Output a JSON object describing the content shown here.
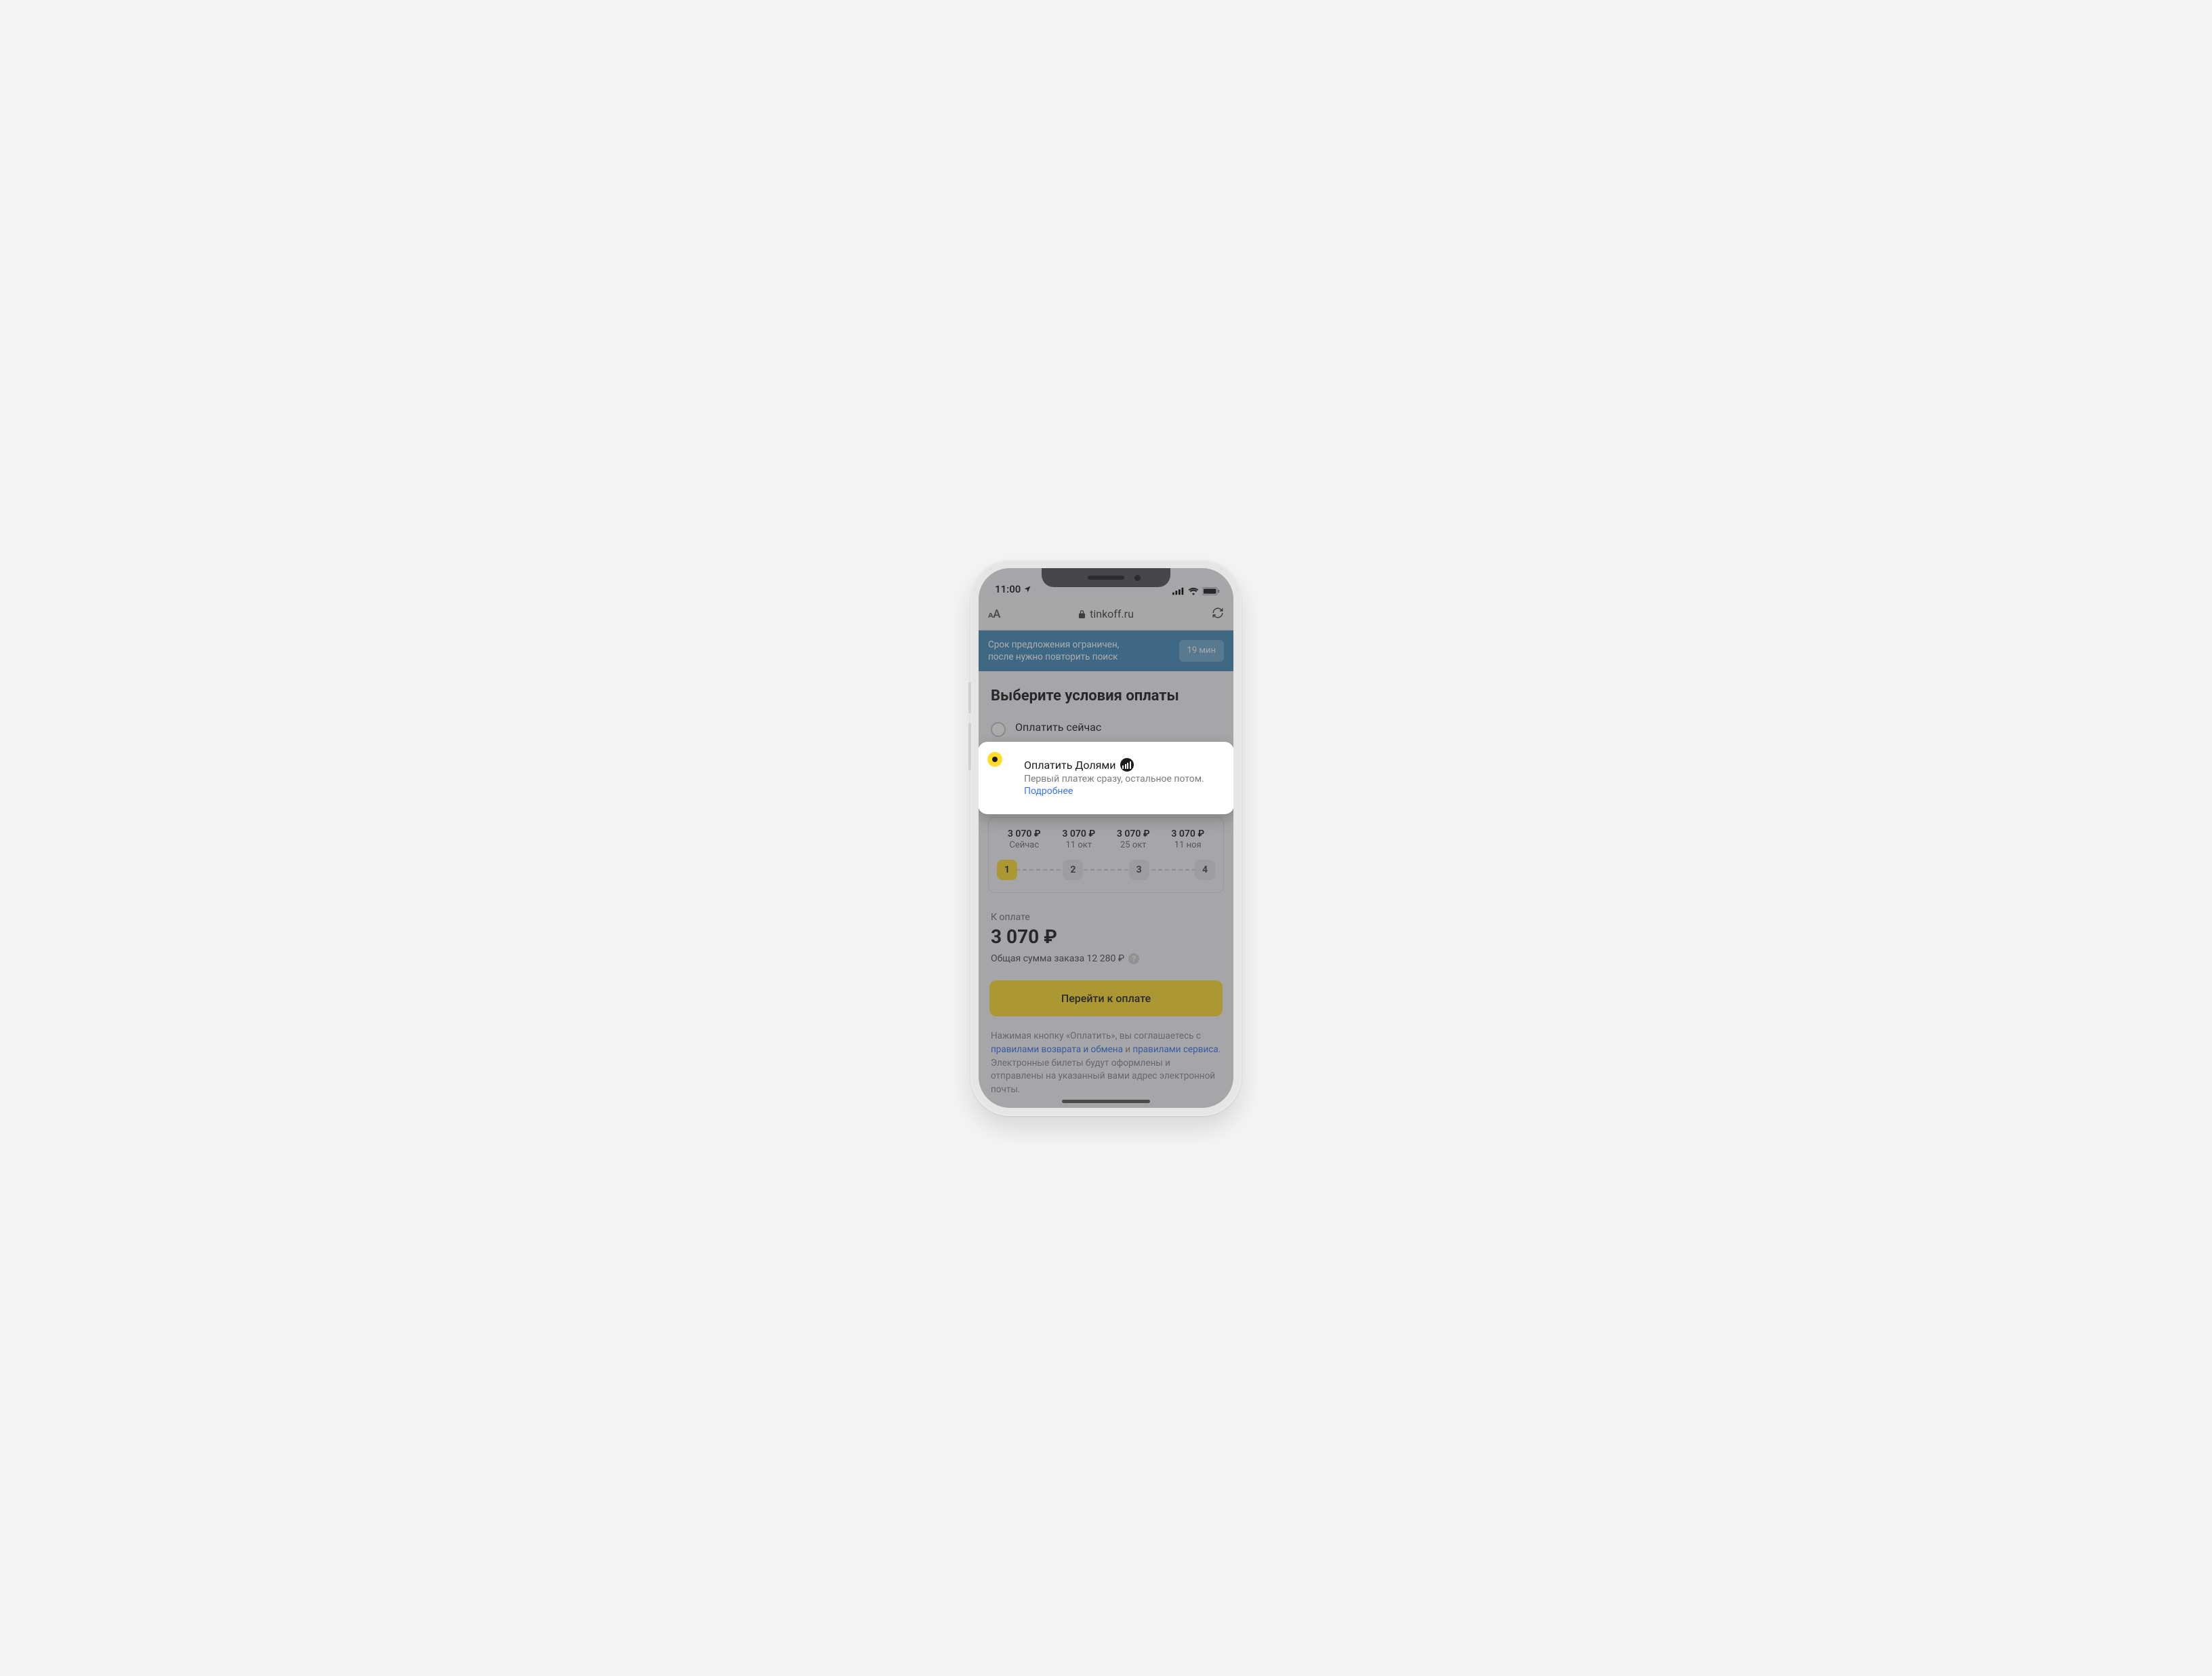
{
  "status": {
    "time": "11:00"
  },
  "safari": {
    "url": "tinkoff.ru"
  },
  "banner": {
    "text": "Срок предложения ограничен, после нужно повторить поиск",
    "badge": "19 мин"
  },
  "title": "Выберите условия оплаты",
  "options": {
    "now": {
      "label": "Оплатить сейчас"
    },
    "dolyami": {
      "label": "Оплатить Долями",
      "sub": "Первый платеж сразу, остальное потом.",
      "more": "Подробнее"
    }
  },
  "steps": [
    {
      "amount": "3 070 ₽",
      "date": "Сейчас",
      "n": "1"
    },
    {
      "amount": "3 070 ₽",
      "date": "11 окт",
      "n": "2"
    },
    {
      "amount": "3 070 ₽",
      "date": "25 окт",
      "n": "3"
    },
    {
      "amount": "3 070 ₽",
      "date": "11 ноя",
      "n": "4"
    }
  ],
  "totals": {
    "caption": "К оплате",
    "due": "3 070 ₽",
    "order_line": "Общая сумма заказа 12 280 ₽"
  },
  "cta": "Перейти к оплате",
  "legal": {
    "t1": "Нажимая кнопку «Оплатить», вы соглашаетесь с ",
    "l1": "правилами возврата и обмена",
    "t2": " и ",
    "l2": "правилами сервиса",
    "t3": ". Электронные билеты будут оформлены и отправлены на указанный вами адрес электронной почты."
  }
}
